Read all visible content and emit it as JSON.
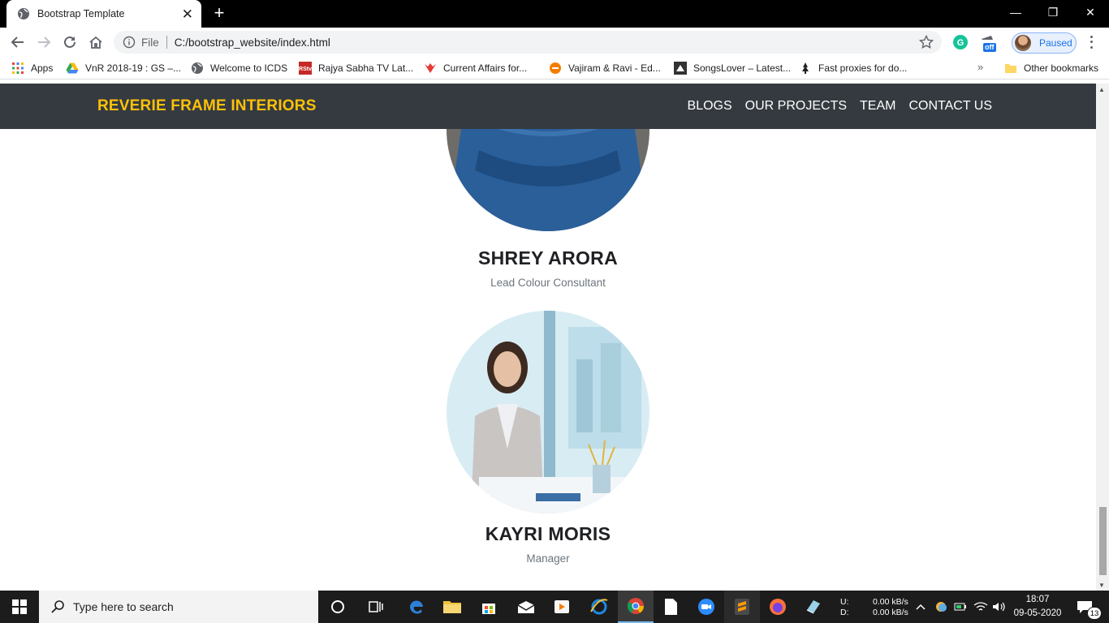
{
  "browser": {
    "tab_title": "Bootstrap Template",
    "tab_close": "✕",
    "new_tab": "+",
    "window_controls": {
      "minimize": "—",
      "restore": "❐",
      "close": "✕"
    },
    "omnibox": {
      "scheme_label": "File",
      "url": "C:/bootstrap_website/index.html"
    },
    "extension_badge": "off",
    "profile_label": "Paused",
    "bookmarks": [
      {
        "label": "Apps",
        "icon": "apps-grid-icon"
      },
      {
        "label": "VnR 2018-19 : GS –...",
        "icon": "google-drive-icon"
      },
      {
        "label": "Welcome to ICDS",
        "icon": "globe-icon"
      },
      {
        "label": "Rajya Sabha TV Lat...",
        "icon": "rstv-icon"
      },
      {
        "label": "Current Affairs for...",
        "icon": "current-affairs-icon"
      },
      {
        "label": "Vajiram & Ravi - Ed...",
        "icon": "vajiram-icon"
      },
      {
        "label": "SongsLover – Latest...",
        "icon": "songslover-icon"
      },
      {
        "label": "Fast proxies for do...",
        "icon": "proxy-icon"
      }
    ],
    "bookmarks_more": "»",
    "other_bookmarks": "Other bookmarks"
  },
  "site": {
    "brand": "REVERIE FRAME INTERIORS",
    "nav": [
      "BLOGS",
      "OUR PROJECTS",
      "TEAM",
      "CONTACT US"
    ],
    "team": [
      {
        "name": "SHREY ARORA",
        "role": "Lead Colour Consultant"
      },
      {
        "name": "KAYRI MORIS",
        "role": "Manager"
      }
    ]
  },
  "taskbar": {
    "search_placeholder": "Type here to search",
    "net_up_label": "U:",
    "net_down_label": "D:",
    "net_up": "0.00 kB/s",
    "net_down": "0.00 kB/s",
    "time": "18:07",
    "date": "09-05-2020",
    "notifications": "13"
  },
  "colors": {
    "brand": "#ffc107",
    "navbar": "#343a40",
    "taskbar": "#1c1c1c"
  }
}
